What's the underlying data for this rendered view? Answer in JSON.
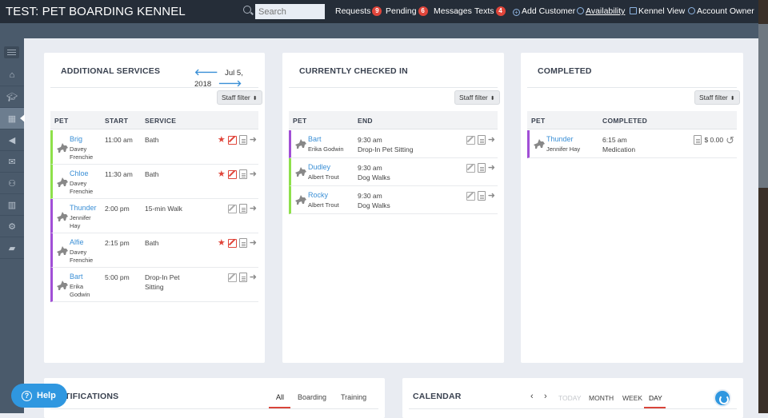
{
  "header": {
    "title": "TEST: PET BOARDING KENNEL",
    "search_placeholder": "Search",
    "nav": [
      {
        "label": "Requests",
        "badge": "9"
      },
      {
        "label": "Pending",
        "badge": "6"
      },
      {
        "label": "Messages"
      },
      {
        "label": "Texts",
        "badge": "4"
      },
      {
        "label": "Add Customer",
        "icon": "plus-circle-icon"
      },
      {
        "label": "Availability",
        "icon": "clock-icon"
      },
      {
        "label": "Kennel View",
        "icon": "calendar-grid-icon"
      },
      {
        "label": "Account Owner",
        "icon": "user-icon"
      }
    ]
  },
  "sidebar": {
    "items": [
      {
        "icon": "home-icon"
      },
      {
        "icon": "graduation-cap-icon"
      },
      {
        "icon": "calendar-icon",
        "active": true
      },
      {
        "icon": "megaphone-icon"
      },
      {
        "icon": "mail-icon"
      },
      {
        "icon": "users-icon"
      },
      {
        "icon": "bar-chart-icon"
      },
      {
        "icon": "gear-icon"
      },
      {
        "icon": "folder-icon"
      }
    ]
  },
  "additional_services": {
    "title": "ADDITIONAL SERVICES",
    "date": "Jul 5, 2018",
    "staff_filter": "Staff filter",
    "columns": [
      "PET",
      "START",
      "SERVICE"
    ],
    "rows": [
      {
        "pet": "Brig",
        "owner1": "Davey",
        "owner2": "Frenchie",
        "start": "11:00 am",
        "service1": "Bath",
        "service2": "",
        "starred": true,
        "color": "green"
      },
      {
        "pet": "Chloe",
        "owner1": "Davey",
        "owner2": "Frenchie",
        "start": "11:30 am",
        "service1": "Bath",
        "service2": "",
        "starred": true,
        "color": "green"
      },
      {
        "pet": "Thunder",
        "owner1": "Jennifer",
        "owner2": "Hay",
        "start": "2:00 pm",
        "service1": "15-min Walk",
        "service2": "",
        "starred": false,
        "color": "purple"
      },
      {
        "pet": "Alfie",
        "owner1": "Davey",
        "owner2": "Frenchie",
        "start": "2:15 pm",
        "service1": "Bath",
        "service2": "",
        "starred": true,
        "color": "purple"
      },
      {
        "pet": "Bart",
        "owner1": "Erika",
        "owner2": "Godwin",
        "start": "5:00 pm",
        "service1": "Drop-In Pet",
        "service2": "Sitting",
        "starred": false,
        "color": "purple"
      }
    ]
  },
  "checked_in": {
    "title": "CURRENTLY CHECKED IN",
    "staff_filter": "Staff filter",
    "columns": [
      "PET",
      "END"
    ],
    "rows": [
      {
        "pet": "Bart",
        "owner": "Erika Godwin",
        "end": "9:30 am",
        "service": "Drop-In Pet Sitting",
        "color": "purple"
      },
      {
        "pet": "Dudley",
        "owner": "Albert Trout",
        "end": "9:30 am",
        "service": "Dog Walks",
        "color": "green"
      },
      {
        "pet": "Rocky",
        "owner": "Albert Trout",
        "end": "9:30 am",
        "service": "Dog Walks",
        "color": "green"
      }
    ]
  },
  "completed": {
    "title": "COMPLETED",
    "staff_filter": "Staff filter",
    "columns": [
      "PET",
      "COMPLETED"
    ],
    "rows": [
      {
        "pet": "Thunder",
        "owner": "Jennifer Hay",
        "time": "6:15 am",
        "service": "Medication",
        "amount": "$ 0.00",
        "color": "purple"
      }
    ]
  },
  "notifications": {
    "title": "NOTIFICATIONS",
    "visible_title": "TIFICATIONS",
    "tabs": [
      "All",
      "Boarding",
      "Training"
    ],
    "active_tab": "All"
  },
  "calendar": {
    "title": "CALENDAR",
    "prev": "‹",
    "next": "›",
    "tabs": [
      "TODAY",
      "MONTH",
      "WEEK",
      "DAY"
    ],
    "active_tab": "DAY"
  },
  "help": {
    "label": "Help"
  },
  "colors": {
    "accent": "#3a8fd6",
    "badge": "#e0453a",
    "green": "#8ee04b",
    "purple": "#a14fd6",
    "topbar": "#252d38"
  }
}
